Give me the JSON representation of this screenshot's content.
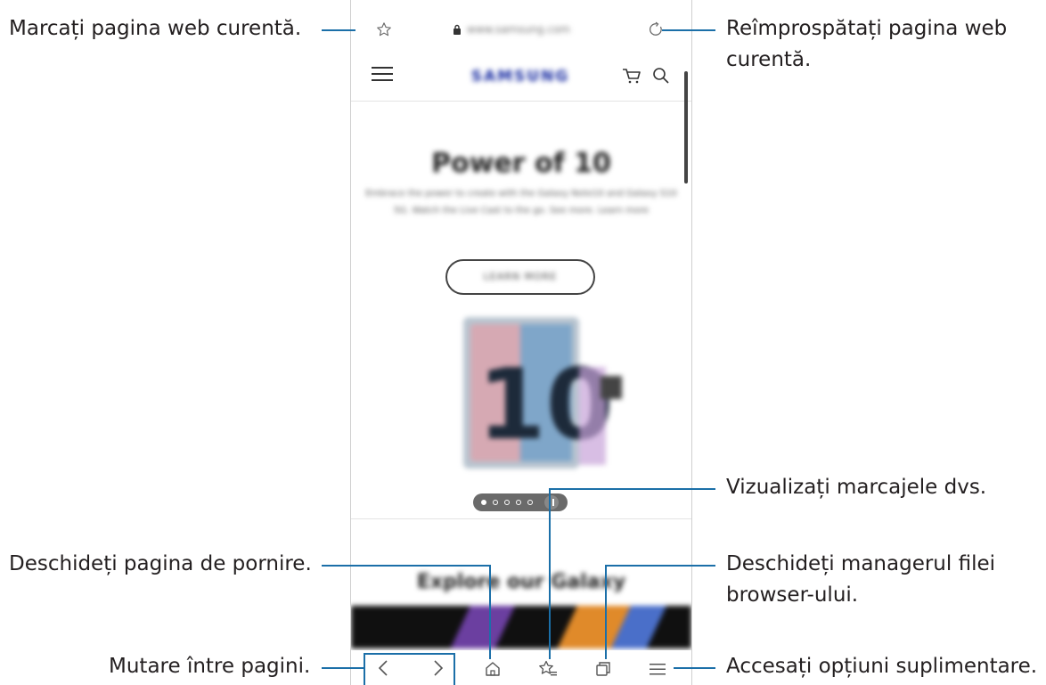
{
  "callouts": {
    "bookmark": "Marcați pagina web curentă.",
    "refresh_line1": "Reîmprospătați pagina web",
    "refresh_line2": "curentă.",
    "view_bookmarks": "Vizualizați marcajele dvs.",
    "home": "Deschideți pagina de pornire.",
    "tab_manager_line1": "Deschideți managerul filei",
    "tab_manager_line2": "browser-ului.",
    "navigate": "Mutare între pagini.",
    "more_options": "Accesați opțiuni suplimentare."
  },
  "browser": {
    "url": "www.samsung.com",
    "brand": "SAMSUNG",
    "hero_title": "Power of 10",
    "hero_text": "Embrace the power to create with the Galaxy Note10 and Galaxy S10 5G. Watch the Live Cast to the go. See more. Learn more",
    "cta_label": "LEARN MORE",
    "section_title": "Explore our Galaxy"
  },
  "colors": {
    "callout_line": "#1b6fa8",
    "icon": "#555555"
  },
  "icons": {
    "bookmark": "star-outline-icon",
    "lock": "lock-icon",
    "refresh": "refresh-icon",
    "menu": "hamburger-menu-icon",
    "cart": "cart-icon",
    "search": "search-icon",
    "back": "chevron-left-icon",
    "forward": "chevron-right-icon",
    "home": "home-icon",
    "bookmarks": "bookmarks-list-icon",
    "tabs": "tabs-icon",
    "more": "menu-lines-icon"
  }
}
